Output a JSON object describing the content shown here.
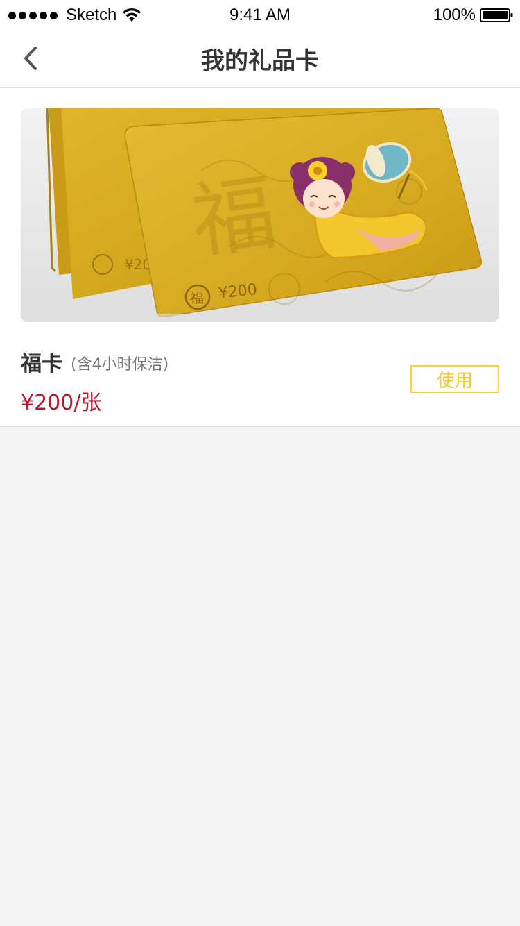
{
  "status_bar": {
    "carrier": "Sketch",
    "time": "9:41 AM",
    "battery": "100%"
  },
  "nav": {
    "title": "我的礼品卡"
  },
  "gift_card": {
    "name": "福卡",
    "note": "(含4小时保洁)",
    "price": "¥200/张",
    "use_label": "使用",
    "face_value": "¥200",
    "emblem_char": "福",
    "watermark_char": "福"
  },
  "colors": {
    "price": "#b4182d",
    "use_button": "#f5c531",
    "card_gold": "#d8ad1e"
  },
  "icons": {
    "back": "chevron-left-icon",
    "wifi": "wifi-icon",
    "battery": "battery-icon",
    "signal": "signal-dots-icon"
  }
}
